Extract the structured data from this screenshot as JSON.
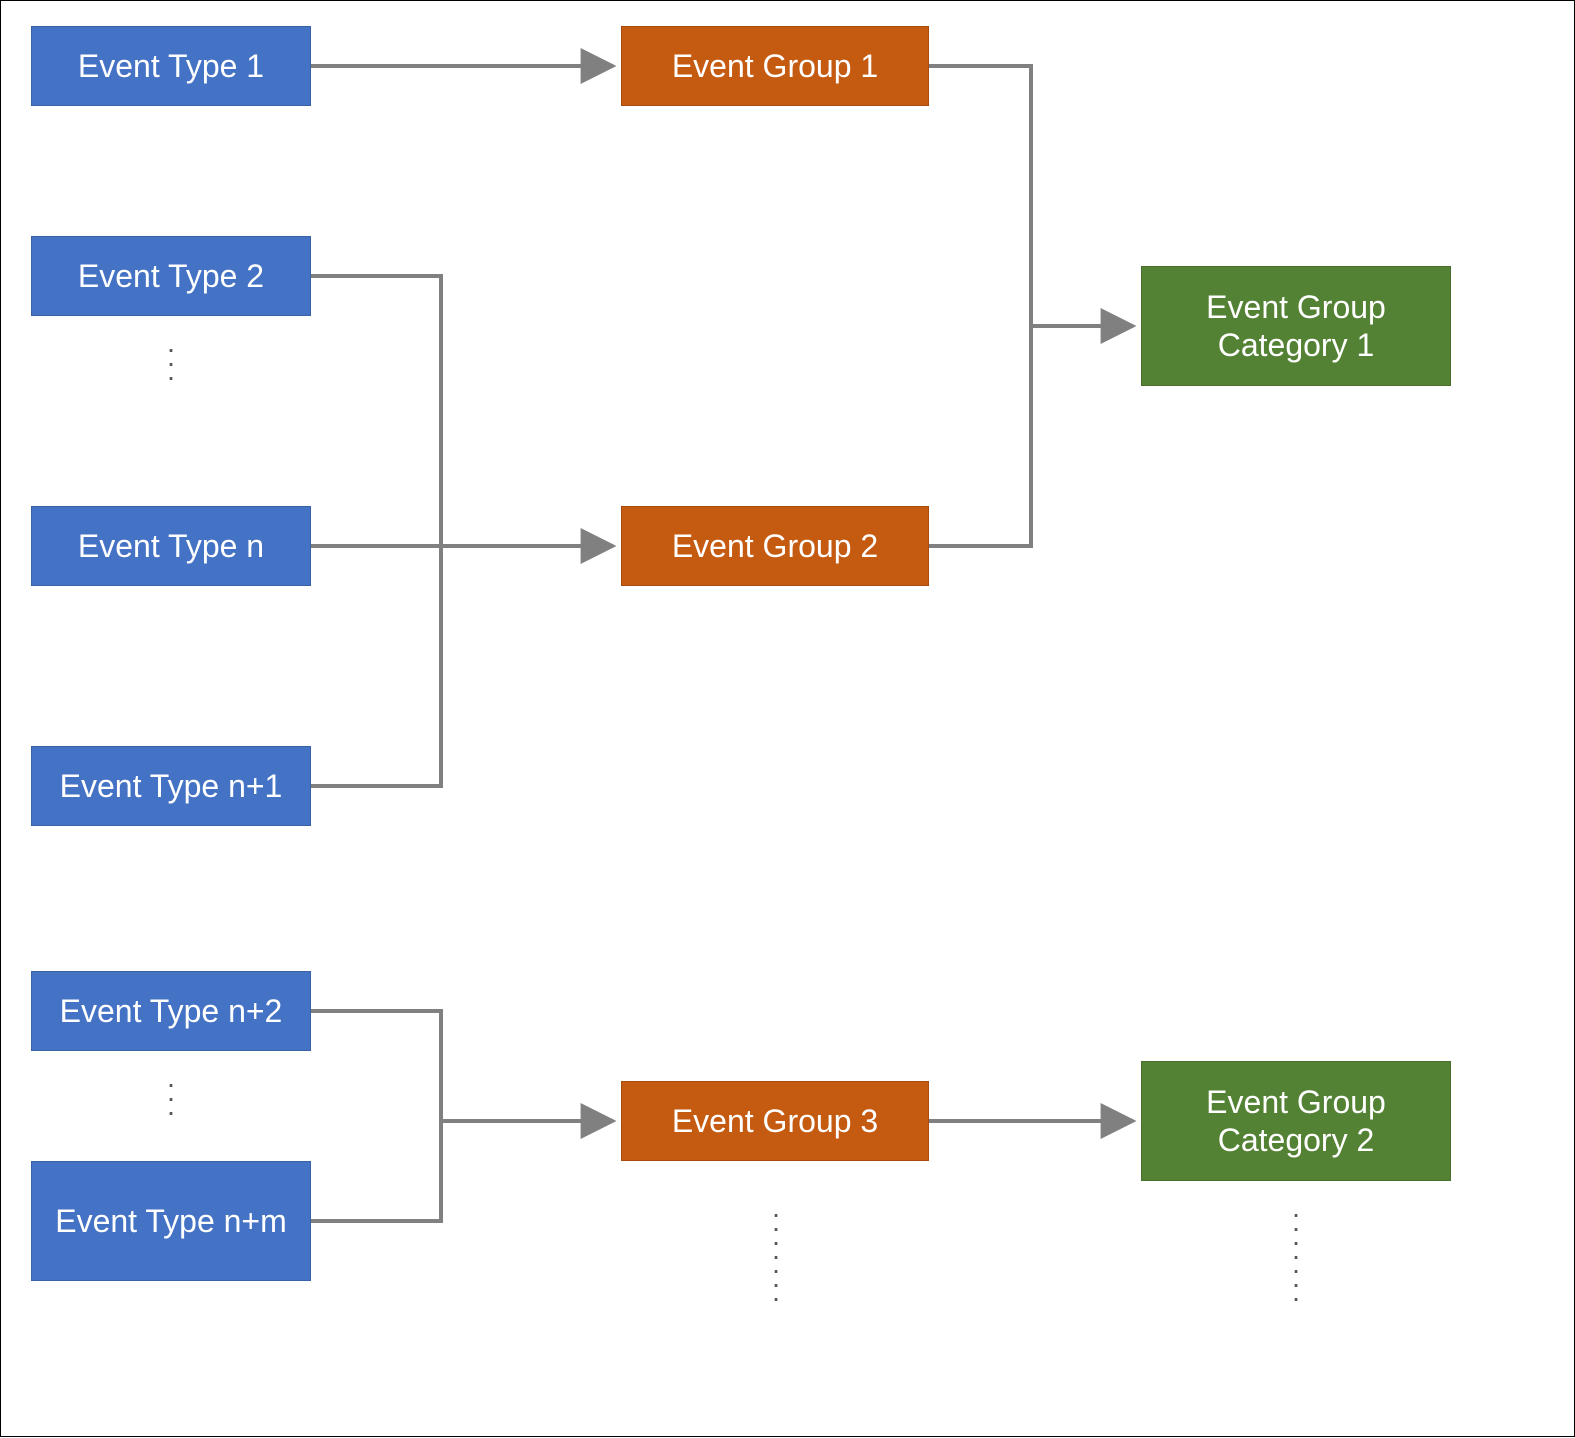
{
  "colors": {
    "event_type": "#4472C4",
    "event_group": "#C55A11",
    "event_category": "#548235",
    "connector": "#808080"
  },
  "event_types": {
    "t1": "Event Type 1",
    "t2": "Event Type 2",
    "tn": "Event Type  n",
    "tn1": "Event Type n+1",
    "tn2": "Event Type n+2",
    "tnm": "Event Type n+m"
  },
  "event_groups": {
    "g1": "Event Group 1",
    "g2": "Event Group 2",
    "g3": "Event Group 3"
  },
  "event_categories": {
    "c1": "Event Group\nCategory 1",
    "c2": "Event Group\nCategory 2"
  },
  "ellipses": {
    "between_t2_tn": ".\n.\n.",
    "between_tn2_tnm": ".\n.\n.",
    "below_g3": ".\n.\n.\n.\n.\n.\n.",
    "below_c2": ".\n.\n.\n.\n.\n.\n."
  }
}
